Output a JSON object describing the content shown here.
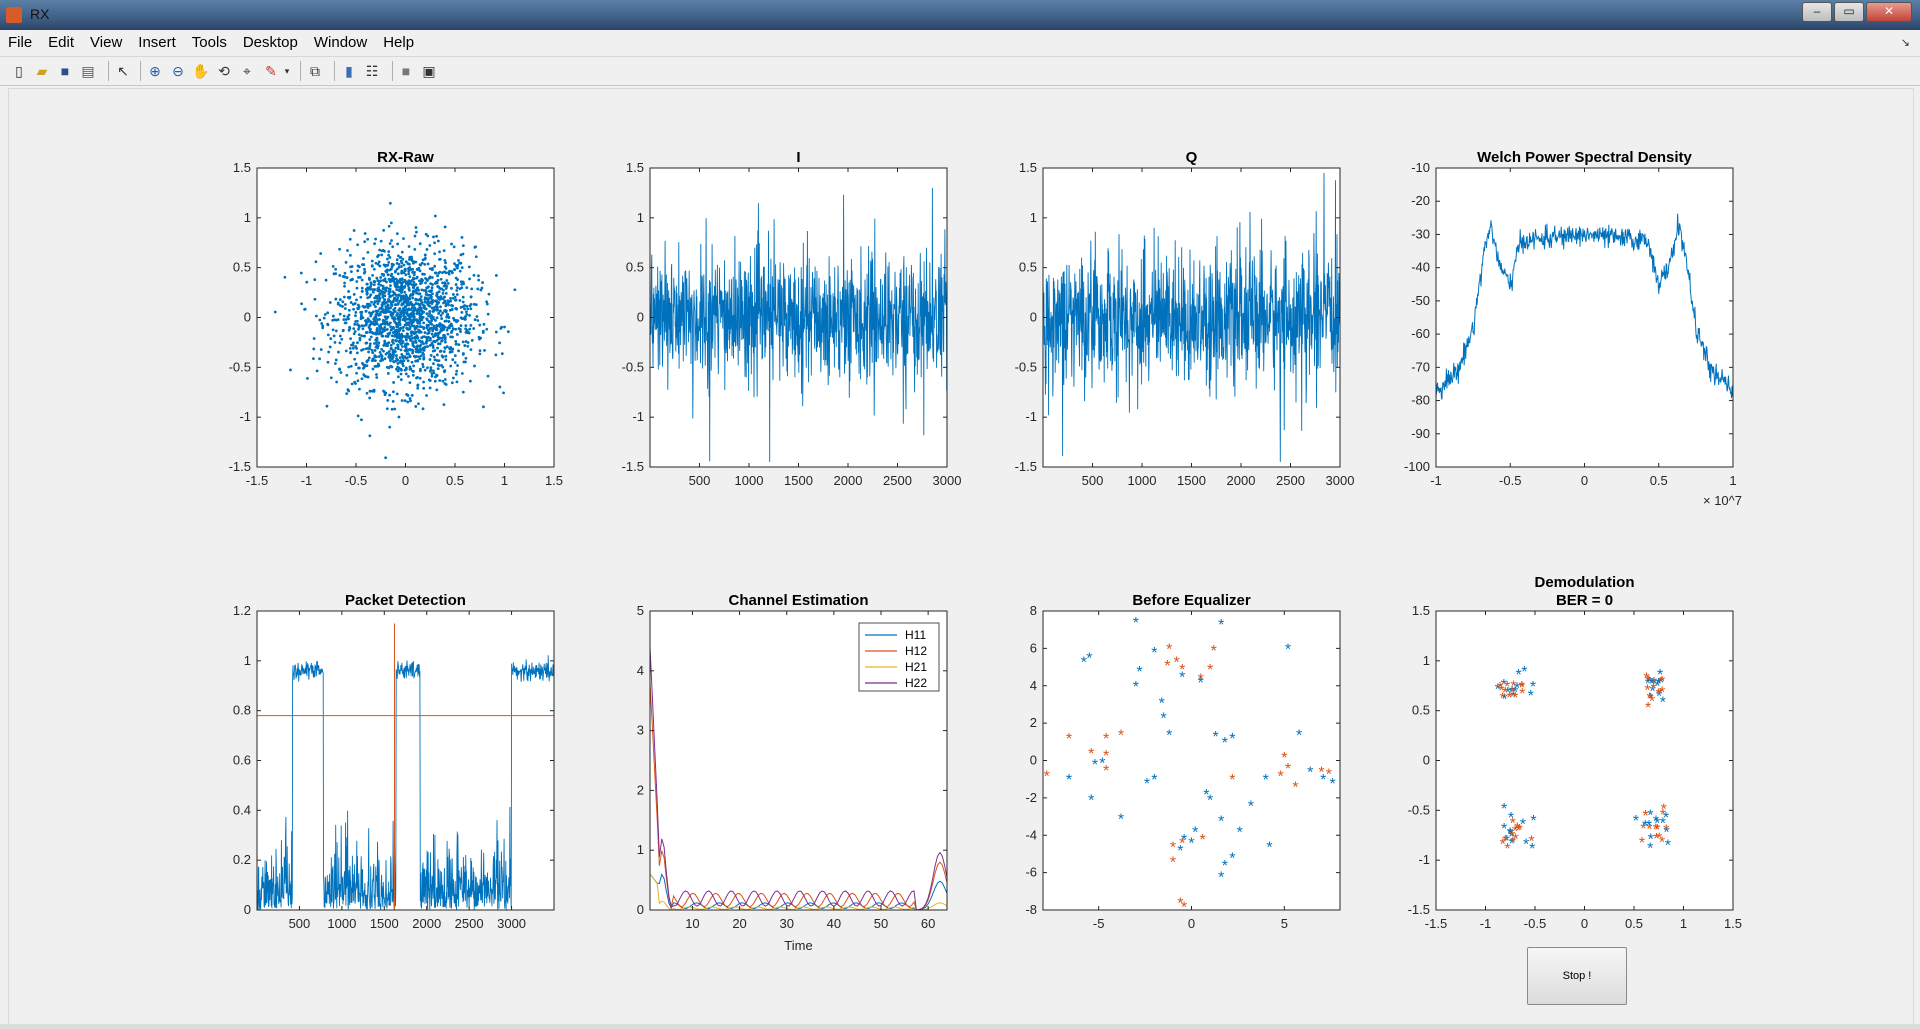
{
  "window": {
    "title": "RX"
  },
  "menu": [
    "File",
    "Edit",
    "View",
    "Insert",
    "Tools",
    "Desktop",
    "Window",
    "Help"
  ],
  "toolbar_icons": [
    "new-figure-icon",
    "open-file-icon",
    "save-icon",
    "print-icon",
    "select-arrow-icon",
    "zoom-in-icon",
    "zoom-out-icon",
    "pan-hand-icon",
    "rotate-3d-icon",
    "data-cursor-icon",
    "brush-icon",
    "brush-dropdown-icon",
    "link-plot-icon",
    "colorbar-icon",
    "legend-icon",
    "hide-plot-tools-icon",
    "show-plot-tools-icon"
  ],
  "stop_button": {
    "label": "Stop !"
  },
  "chart_data": [
    {
      "type": "scatter",
      "title": "RX-Raw",
      "xlim": [
        -1.5,
        1.5
      ],
      "ylim": [
        -1.5,
        1.5
      ],
      "xticks": [
        "-1.5",
        "-1",
        "-0.5",
        "0",
        "0.5",
        "1",
        "1.5"
      ],
      "yticks": [
        "-1.5",
        "-1",
        "-0.5",
        "0",
        "0.5",
        "1",
        "1.5"
      ],
      "distribution": "gaussian cloud centered at (0,0), std ≈ 0.35",
      "color": "#0072bd",
      "grid": false
    },
    {
      "type": "line",
      "title": "I",
      "xlim": [
        0,
        3000
      ],
      "ylim": [
        -1.5,
        1.5
      ],
      "xticks": [
        "500",
        "1000",
        "1500",
        "2000",
        "2500",
        "3000"
      ],
      "yticks": [
        "-1.5",
        "-1",
        "-0.5",
        "0",
        "0.5",
        "1",
        "1.5"
      ],
      "color": "#0072bd",
      "grid": false
    },
    {
      "type": "line",
      "title": "Q",
      "xlim": [
        0,
        3000
      ],
      "ylim": [
        -1.5,
        1.5
      ],
      "xticks": [
        "500",
        "1000",
        "1500",
        "2000",
        "2500",
        "3000"
      ],
      "yticks": [
        "-1.5",
        "-1",
        "-0.5",
        "0",
        "0.5",
        "1",
        "1.5"
      ],
      "color": "#0072bd",
      "grid": false
    },
    {
      "type": "line",
      "title": "Welch Power Spectral Density",
      "xlim": [
        -1,
        1
      ],
      "ylim": [
        -100,
        -10
      ],
      "xticks": [
        "-1",
        "-0.5",
        "0",
        "0.5",
        "1"
      ],
      "yticks": [
        "-100",
        "-90",
        "-80",
        "-70",
        "-60",
        "-50",
        "-40",
        "-30",
        "-20",
        "-10"
      ],
      "x_exponent": "10^7",
      "shape": [
        [
          -1,
          -77
        ],
        [
          -0.85,
          -71
        ],
        [
          -0.75,
          -58
        ],
        [
          -0.68,
          -36
        ],
        [
          -0.63,
          -27
        ],
        [
          -0.57,
          -40
        ],
        [
          -0.5,
          -45
        ],
        [
          -0.43,
          -32
        ],
        [
          0,
          -30
        ],
        [
          0.43,
          -32
        ],
        [
          0.5,
          -45
        ],
        [
          0.57,
          -40
        ],
        [
          0.63,
          -27
        ],
        [
          0.68,
          -36
        ],
        [
          0.75,
          -58
        ],
        [
          0.85,
          -71
        ],
        [
          1,
          -77
        ]
      ],
      "color": "#0072bd",
      "grid": false
    },
    {
      "type": "line",
      "title": "Packet Detection",
      "xlim": [
        0,
        3500
      ],
      "ylim": [
        0,
        1.2
      ],
      "xticks": [
        "500",
        "1000",
        "1500",
        "2000",
        "2500",
        "3000"
      ],
      "yticks": [
        "0",
        "0.2",
        "0.4",
        "0.6",
        "0.8",
        "1",
        "1.2"
      ],
      "threshold": 0.78,
      "marker_x": 1620,
      "marker_peak": 1.15,
      "plateaus": [
        [
          420,
          780
        ],
        [
          1640,
          1920
        ],
        [
          3000,
          3500
        ]
      ],
      "color": "#0072bd",
      "threshold_color": "#d95319",
      "grid": false
    },
    {
      "type": "line",
      "title": "Channel Estimation",
      "xlabel": "Time",
      "xlim": [
        1,
        64
      ],
      "ylim": [
        0,
        5
      ],
      "xticks": [
        "10",
        "20",
        "30",
        "40",
        "50",
        "60"
      ],
      "yticks": [
        "0",
        "1",
        "2",
        "3",
        "4",
        "5"
      ],
      "series": [
        {
          "name": "H11",
          "color": "#0072bd"
        },
        {
          "name": "H12",
          "color": "#d95319"
        },
        {
          "name": "H21",
          "color": "#edb120"
        },
        {
          "name": "H22",
          "color": "#7e2f8e"
        }
      ],
      "legend": "top-right",
      "grid": false
    },
    {
      "type": "scatter",
      "title": "Before Equalizer",
      "xlim": [
        -8,
        8
      ],
      "ylim": [
        -8,
        8
      ],
      "xticks": [
        "-5",
        "0",
        "5"
      ],
      "yticks": [
        "-8",
        "-6",
        "-4",
        "-2",
        "0",
        "2",
        "4",
        "6",
        "8"
      ],
      "marker": "*",
      "series": [
        {
          "color": "#0072bd",
          "points": [
            [
              -5.5,
              5.5
            ],
            [
              -5.8,
              5.3
            ],
            [
              -3,
              7.4
            ],
            [
              -2.8,
              4.8
            ],
            [
              -3,
              4
            ],
            [
              -2,
              5.8
            ],
            [
              -1.6,
              3.1
            ],
            [
              -1.5,
              2.3
            ],
            [
              -1.2,
              1.4
            ],
            [
              -0.5,
              4.5
            ],
            [
              0.5,
              4.2
            ],
            [
              1.6,
              7.3
            ],
            [
              1.3,
              1.3
            ],
            [
              1.8,
              1.0
            ],
            [
              2.2,
              1.2
            ],
            [
              -2,
              -1
            ],
            [
              -2.4,
              -1.2
            ],
            [
              -6.6,
              -1
            ],
            [
              -5.4,
              -2.1
            ],
            [
              -3.8,
              -3.1
            ],
            [
              -5.2,
              -0.2
            ],
            [
              -4.8,
              -0.1
            ],
            [
              0.8,
              -1.8
            ],
            [
              1.0,
              -2.1
            ],
            [
              1.6,
              -3.2
            ],
            [
              0.2,
              -3.8
            ],
            [
              2.6,
              -3.8
            ],
            [
              3.2,
              -2.4
            ],
            [
              1.8,
              -5.6
            ],
            [
              2.2,
              -5.2
            ],
            [
              1.6,
              -6.2
            ],
            [
              4.2,
              -4.6
            ],
            [
              4.0,
              -1.0
            ],
            [
              5.2,
              6.0
            ],
            [
              5.8,
              1.4
            ],
            [
              6.4,
              -0.6
            ],
            [
              7.6,
              -1.2
            ],
            [
              7.1,
              -1.0
            ],
            [
              0.0,
              -4.4
            ],
            [
              -0.6,
              -4.8
            ],
            [
              -0.4,
              -4.2
            ]
          ]
        },
        {
          "color": "#d95319",
          "points": [
            [
              -7.8,
              -0.8
            ],
            [
              -6.6,
              1.2
            ],
            [
              -5.4,
              0.4
            ],
            [
              -4.6,
              1.2
            ],
            [
              -3.8,
              1.4
            ],
            [
              -4.6,
              0.3
            ],
            [
              -4.6,
              -0.5
            ],
            [
              -1.2,
              6.0
            ],
            [
              -0.8,
              5.3
            ],
            [
              -0.5,
              4.9
            ],
            [
              0.5,
              4.4
            ],
            [
              1.2,
              5.9
            ],
            [
              1.0,
              4.9
            ],
            [
              -1.0,
              -4.6
            ],
            [
              -0.5,
              -4.4
            ],
            [
              0.6,
              -4.2
            ],
            [
              -1.0,
              -5.4
            ],
            [
              -0.6,
              -7.6
            ],
            [
              -0.4,
              -7.8
            ],
            [
              5.0,
              0.2
            ],
            [
              5.2,
              -0.4
            ],
            [
              4.8,
              -0.8
            ],
            [
              5.6,
              -1.4
            ],
            [
              7.0,
              -0.6
            ],
            [
              7.4,
              -0.7
            ],
            [
              2.2,
              -1.0
            ],
            [
              -1.3,
              5.1
            ]
          ]
        }
      ],
      "grid": false
    },
    {
      "type": "scatter",
      "title": "Demodulation",
      "subtitle": "BER = 0",
      "xlim": [
        -1.5,
        1.5
      ],
      "ylim": [
        -1.5,
        1.5
      ],
      "xticks": [
        "-1.5",
        "-1",
        "-0.5",
        "0",
        "0.5",
        "1",
        "1.5"
      ],
      "yticks": [
        "-1.5",
        "-1",
        "-0.5",
        "0",
        "0.5",
        "1",
        "1.5"
      ],
      "marker": "*",
      "clusters": [
        [
          -0.7,
          0.7
        ],
        [
          0.7,
          0.7
        ],
        [
          -0.7,
          -0.7
        ],
        [
          0.7,
          -0.7
        ]
      ],
      "series": [
        {
          "color": "#0072bd"
        },
        {
          "color": "#d95319"
        }
      ],
      "grid": false
    }
  ]
}
